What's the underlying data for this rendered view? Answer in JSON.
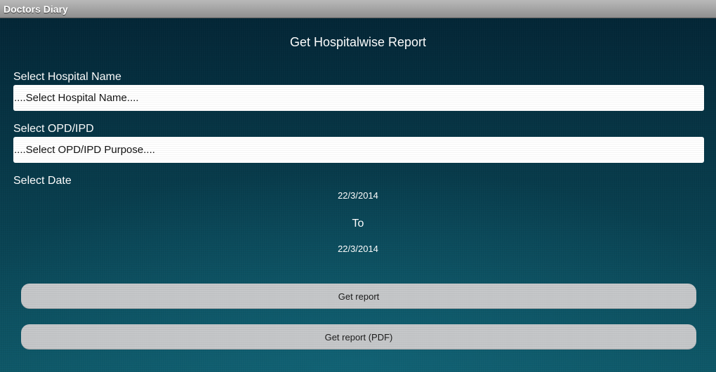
{
  "app": {
    "title": "Doctors Diary"
  },
  "page": {
    "title": "Get Hospitalwise Report"
  },
  "hospital": {
    "label": "Select Hospital Name",
    "selected": "....Select Hospital Name...."
  },
  "opd_ipd": {
    "label": "Select OPD/IPD",
    "selected": "....Select OPD/IPD Purpose...."
  },
  "date": {
    "label": "Select Date",
    "from": "22/3/2014",
    "separator": "To",
    "to": "22/3/2014"
  },
  "actions": {
    "get_report": "Get report",
    "get_report_pdf": "Get report (PDF)"
  },
  "colors": {
    "background": "#06303f",
    "titlebar": "#a9a9a9",
    "button": "#c5c7c9",
    "text": "#ffffff"
  }
}
